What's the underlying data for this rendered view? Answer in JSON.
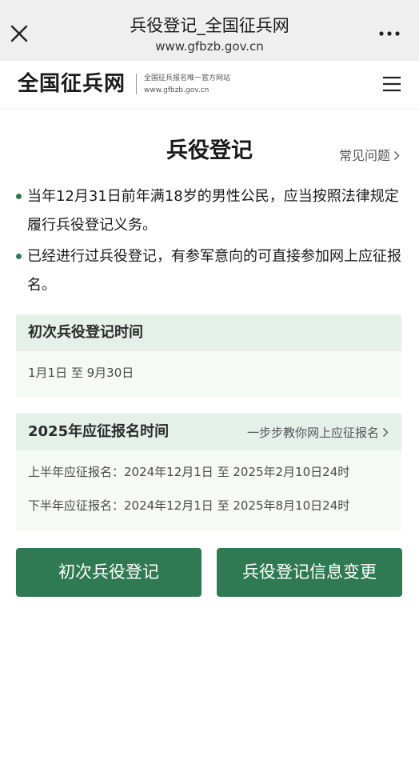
{
  "browser": {
    "title": "兵役登记_全国征兵网",
    "url": "www.gfbzb.gov.cn"
  },
  "site": {
    "logo": "全国征兵网",
    "tagline": "全国征兵报名唯一官方网站",
    "domain": "www.gfbzb.gov.cn"
  },
  "main": {
    "title": "兵役登记",
    "faq_label": "常见问题",
    "bullets": [
      "当年12月31日前年满18岁的男性公民，应当按照法律规定履行兵役登记义务。",
      "已经进行过兵役登记，有参军意向的可直接参加网上应征报名。"
    ]
  },
  "first_registration": {
    "title": "初次兵役登记时间",
    "period": "1月1日 至 9月30日"
  },
  "enlistment": {
    "title": "2025年应征报名时间",
    "guide_label": "一步步教你网上应征报名",
    "first_half": "上半年应征报名：2024年12月1日 至 2025年2月10日24时",
    "second_half": "下半年应征报名：2024年12月1日 至 2025年8月10日24时"
  },
  "buttons": {
    "register": "初次兵役登记",
    "change": "兵役登记信息变更"
  },
  "colors": {
    "primary": "#2f7a52",
    "card_header": "#e4f0e8",
    "card_body": "#f6faf7"
  },
  "icons": {
    "close": "close-icon",
    "more": "more-dots-icon",
    "menu": "hamburger-menu-icon",
    "chevron": "chevron-right-icon"
  }
}
